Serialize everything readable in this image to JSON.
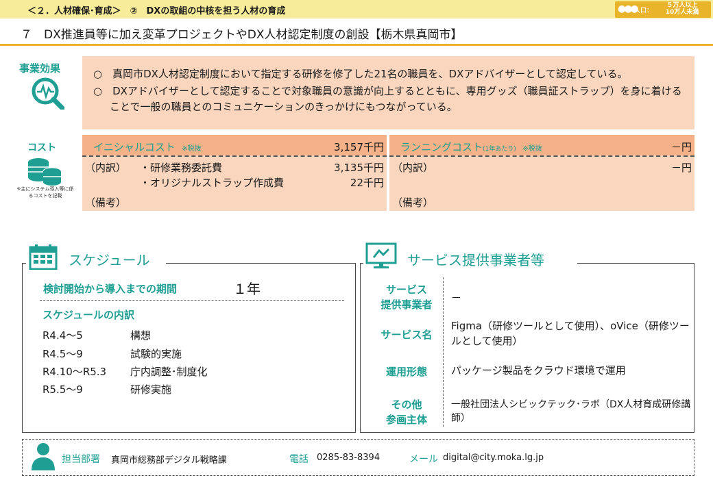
{
  "header": {
    "section": "＜２．人材確保･育成＞　②　DXの取組の中核を担う人材の育成",
    "population_label": "人口：",
    "population_value": "５万人以上\n10万人未満"
  },
  "title": "７　DX推進員等に加え変革プロジェクトやDX人材認定制度の創設【栃木県真岡市】",
  "effects": {
    "label": "事業効果",
    "items": [
      "○　真岡市DX人材認定制度において指定する研修を修了した21名の職員を、DXアドバイザーとして認定している。",
      "○　DXアドバイザーとして認定することで対象職員の意識が向上するとともに、専用グッズ（職員証ストラップ）を身に着けることで一般の職員とのコミュニケーションのきっかけにもつながっている。"
    ]
  },
  "cost": {
    "label": "コスト",
    "note": "※主にシステム導入等に係るコストを記載",
    "initial": {
      "title": "イニシャルコスト",
      "tax_note": "※税抜",
      "total": "3,157千円",
      "breakdown_label": "（内訳）",
      "items": [
        {
          "name": "・研修業務委託費",
          "amount": "3,135千円"
        },
        {
          "name": "・オリジナルストラップ作成費",
          "amount": "22千円"
        }
      ],
      "remarks_label": "（備考）"
    },
    "running": {
      "title": "ランニングコスト",
      "sub": "(1年あたり)",
      "tax_note": "※税抜",
      "total": "－円",
      "breakdown_label": "（内訳）",
      "breakdown_value": "－円",
      "remarks_label": "（備考）"
    }
  },
  "schedule": {
    "heading": "スケジュール",
    "period_label": "検討開始から導入までの期間",
    "period_value": "１年",
    "breakdown_label": "スケジュールの内訳",
    "rows": [
      {
        "term": "R4.4～5",
        "desc": "構想"
      },
      {
        "term": "R4.5～9",
        "desc": "試験的実施"
      },
      {
        "term": "R4.10～R5.3",
        "desc": "庁内調整･制度化"
      },
      {
        "term": "R5.5～9",
        "desc": "研修実施"
      }
    ]
  },
  "service": {
    "heading": "サービス提供事業者等",
    "provider_label": "サービス\n提供事業者",
    "provider_value": "－",
    "name_label": "サービス名",
    "name_value": "Figma（研修ツールとして使用）、oVice（研修ツールとして使用）",
    "mode_label": "運用形態",
    "mode_value": "パッケージ製品をクラウド環境で運用",
    "other_label": "その他\n参画主体",
    "other_value": "一般社団法人シビックテック･ラボ（DX人材育成研修講師）"
  },
  "contact": {
    "dept_label": "担当部署",
    "dept_value": "真岡市総務部デジタル戦略課",
    "tel_label": "電話",
    "tel_value": "0285-83-8394",
    "mail_label": "メール",
    "mail_value": "digital@city.moka.lg.jp"
  },
  "colors": {
    "accent": "#1f9f93",
    "header_bg": "#f7ec9a",
    "badge": "#e9b32a",
    "panel": "#fad6bf",
    "panel_header": "#f5b187"
  },
  "icons": [
    "magnifier-chart-icon",
    "coins-icon",
    "calendar-icon",
    "monitor-icon",
    "person-icon",
    "people-icon"
  ]
}
